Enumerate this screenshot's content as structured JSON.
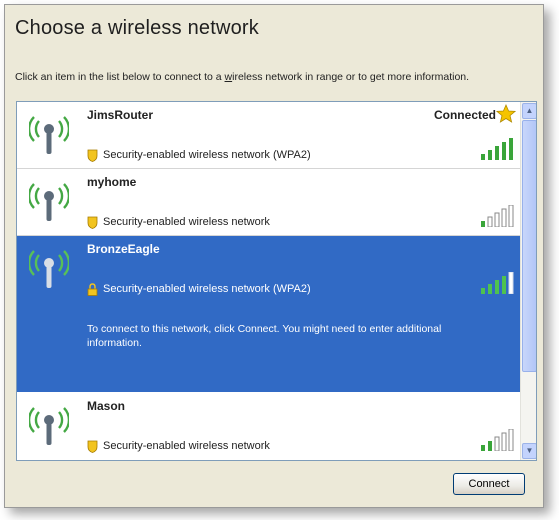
{
  "window": {
    "title": "Choose a wireless network",
    "instruction_pre": "Click an item in the list below to connect to a ",
    "instruction_link": "w",
    "instruction_post": "ireless network in range or to get more information."
  },
  "networks": [
    {
      "name": "JimsRouter",
      "status": "Connected",
      "security": "Security-enabled wireless network (WPA2)",
      "signal_bars": 5
    },
    {
      "name": "myhome",
      "status": "",
      "security": "Security-enabled wireless network",
      "signal_bars": 1
    },
    {
      "name": "BronzeEagle",
      "status": "",
      "security": "Security-enabled wireless network (WPA2)",
      "signal_bars": 4,
      "hint": "To connect to this network, click Connect. You might need to enter additional information."
    },
    {
      "name": "Mason",
      "status": "",
      "security": "Security-enabled wireless network",
      "signal_bars": 2
    }
  ],
  "buttons": {
    "connect": "Connect"
  },
  "colors": {
    "selected_bg": "#316ac5",
    "signal_green": "#3aa53a",
    "star_gold": "#f5c400"
  },
  "icons": {
    "network": "antenna-icon",
    "security": "shield-icon",
    "favorite": "star-icon",
    "signal": "signal-strength-icon"
  }
}
